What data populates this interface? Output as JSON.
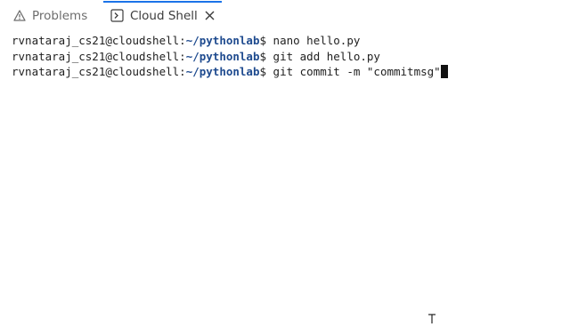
{
  "tabs": [
    {
      "label": "Problems",
      "icon": "warning-icon"
    },
    {
      "label": "Cloud Shell",
      "icon": "terminal-icon",
      "active": true
    }
  ],
  "terminal": {
    "lines": [
      {
        "user": "rvnataraj_cs21@cloudshell",
        "path": "~/pythonlab",
        "prompt": "$",
        "command": " nano hello.py"
      },
      {
        "user": "rvnataraj_cs21@cloudshell",
        "path": "~/pythonlab",
        "prompt": "$",
        "command": " git add hello.py"
      },
      {
        "user": "rvnataraj_cs21@cloudshell",
        "path": "~/pythonlab",
        "prompt": "$",
        "command": " git commit -m \"commitmsg\""
      }
    ]
  },
  "colors": {
    "active_tab_accent": "#1a73e8",
    "path": "#1f4b8f"
  }
}
